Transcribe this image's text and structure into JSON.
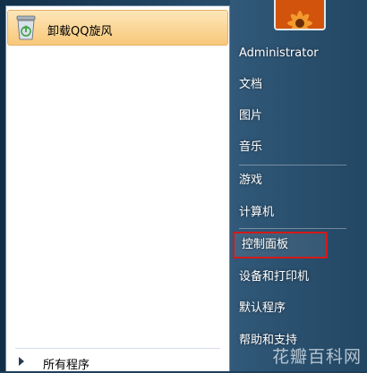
{
  "pinned": {
    "label": "卸载QQ旋风",
    "icon": "recycle-bin-icon"
  },
  "all_programs": {
    "label": "所有程序",
    "icon": "triangle-right-icon"
  },
  "user": {
    "name": "Administrator",
    "picture_icon": "flower-avatar-icon"
  },
  "right_menu": [
    {
      "label": "文档"
    },
    {
      "label": "图片"
    },
    {
      "label": "音乐"
    },
    {
      "label": "游戏"
    },
    {
      "label": "计算机"
    },
    {
      "label": "控制面板"
    },
    {
      "label": "设备和打印机"
    },
    {
      "label": "默认程序"
    },
    {
      "label": "帮助和支持"
    }
  ],
  "watermark": "花瓣百科网",
  "colors": {
    "highlight_border": "#d21a1a",
    "pinned_bg": "#f8c87a"
  }
}
